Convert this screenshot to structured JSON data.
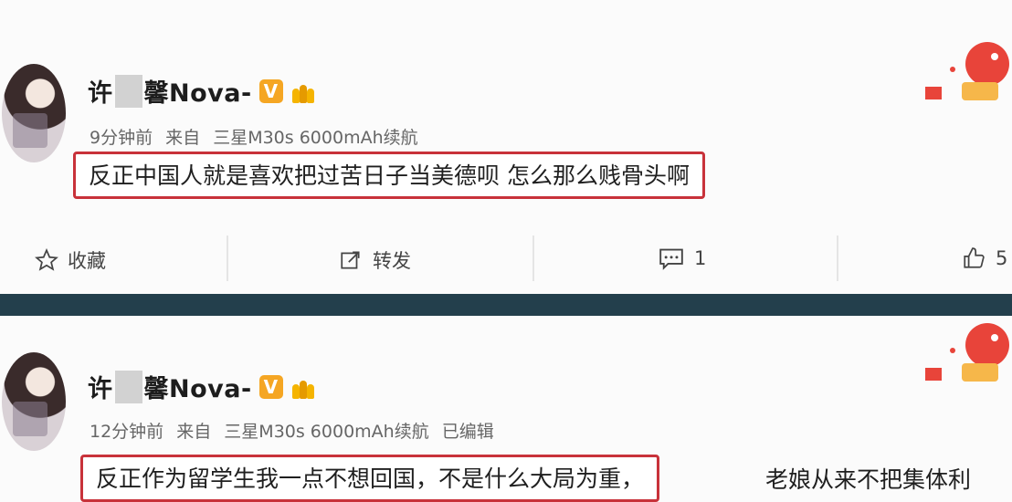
{
  "posts": [
    {
      "name_prefix": "许",
      "name_suffix": "馨Nova-",
      "verified_badge": "V",
      "time": "9分钟前",
      "source_label": "来自",
      "source_device": "三星M30s 6000mAh续航",
      "edited": "",
      "highlight_text": "反正中国人就是喜欢把过苦日子当美德呗 怎么那么贱骨头啊",
      "trail_text": "",
      "actions": {
        "favorite": "收藏",
        "repost": "转发",
        "comment_count": "1",
        "like_count": "5"
      }
    },
    {
      "name_prefix": "许",
      "name_suffix": "馨Nova-",
      "verified_badge": "V",
      "time": "12分钟前",
      "source_label": "来自",
      "source_device": "三星M30s 6000mAh续航",
      "edited": "已编辑",
      "highlight_text": "反正作为留学生我一点不想回国，不是什么大局为重，",
      "trail_text": "老娘从来不把集体利"
    }
  ],
  "colors": {
    "highlight_border": "#c8323a",
    "divider": "#233f4c",
    "verified_badge": "#f5a623"
  }
}
